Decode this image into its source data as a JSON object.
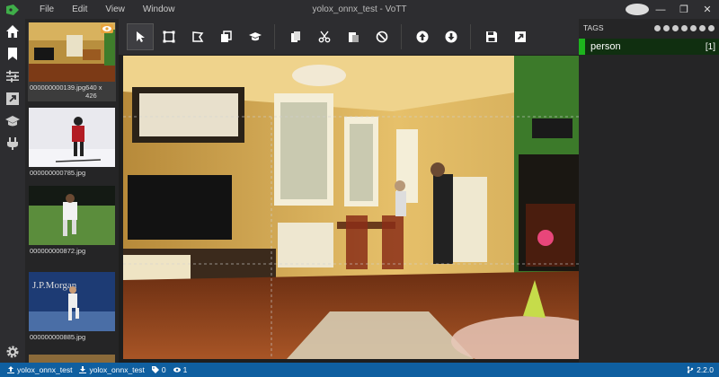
{
  "window": {
    "title": "yolox_onnx_test - VoTT"
  },
  "menu": [
    "File",
    "Edit",
    "View",
    "Window"
  ],
  "thumbnails": [
    {
      "filename": "000000000139.jpg",
      "size": "640 x 426",
      "selected": true
    },
    {
      "filename": "000000000785.jpg",
      "size": "",
      "selected": false
    },
    {
      "filename": "000000000872.jpg",
      "size": "",
      "selected": false
    },
    {
      "filename": "000000000885.jpg",
      "size": "",
      "selected": false
    }
  ],
  "tags": {
    "title": "TAGS",
    "items": [
      {
        "name": "person",
        "count": "[1]",
        "color": "#1db41d"
      }
    ]
  },
  "status": {
    "project": "yolox_onnx_test",
    "target": "yolox_onnx_test",
    "tag_count": "0",
    "visited_count": "1",
    "version": "2.2.0"
  },
  "colors": {
    "accent": "#0f5fa0",
    "tag_person": "#1db41d",
    "badge": "#e8a33c"
  }
}
